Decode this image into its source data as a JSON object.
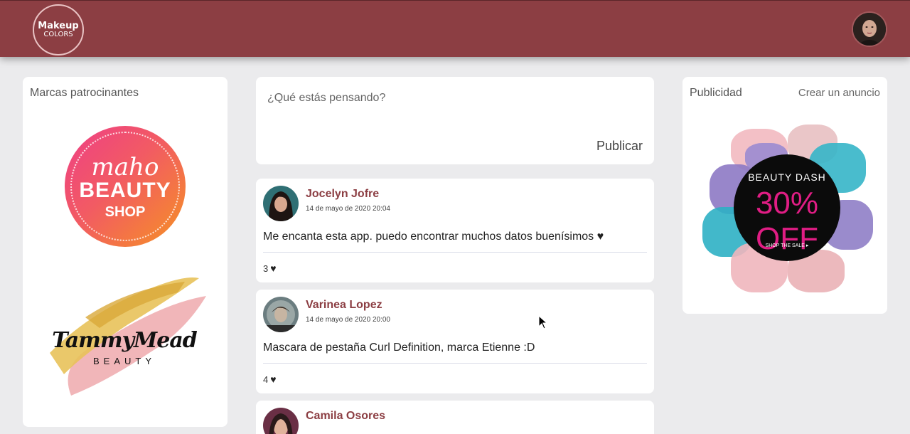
{
  "header": {
    "logo_line1": "Makeup",
    "logo_line2": "COLORS",
    "brand_color": "#8c3e43"
  },
  "sponsors": {
    "title": "Marcas patrocinantes",
    "brand1": {
      "line1": "maho",
      "line2": "BEAUTY",
      "line3": "SHOP"
    },
    "brand2": {
      "line1": "TammyMead",
      "line2": "BEAUTY"
    }
  },
  "composer": {
    "placeholder": "¿Qué estás pensando?",
    "publish_label": "Publicar"
  },
  "posts": [
    {
      "author": "Jocelyn Jofre",
      "date": "14 de mayo de 2020 20:04",
      "text": "Me encanta esta app. puedo encontrar muchos datos buenísimos ♥",
      "likes": "3"
    },
    {
      "author": "Varinea Lopez",
      "date": "14 de mayo de 2020 20:00",
      "text": "Mascara de pestaña Curl Definition, marca Etienne :D",
      "likes": "4"
    },
    {
      "author": "Camila Osores"
    }
  ],
  "ads": {
    "title": "Publicidad",
    "create_link": "Crear un anuncio",
    "banner": {
      "line1": "BEAUTY DASH",
      "line2": "30% OFF",
      "line3": "SHOP THE SALE ▸"
    }
  },
  "icons": {
    "like": "heart-icon"
  }
}
